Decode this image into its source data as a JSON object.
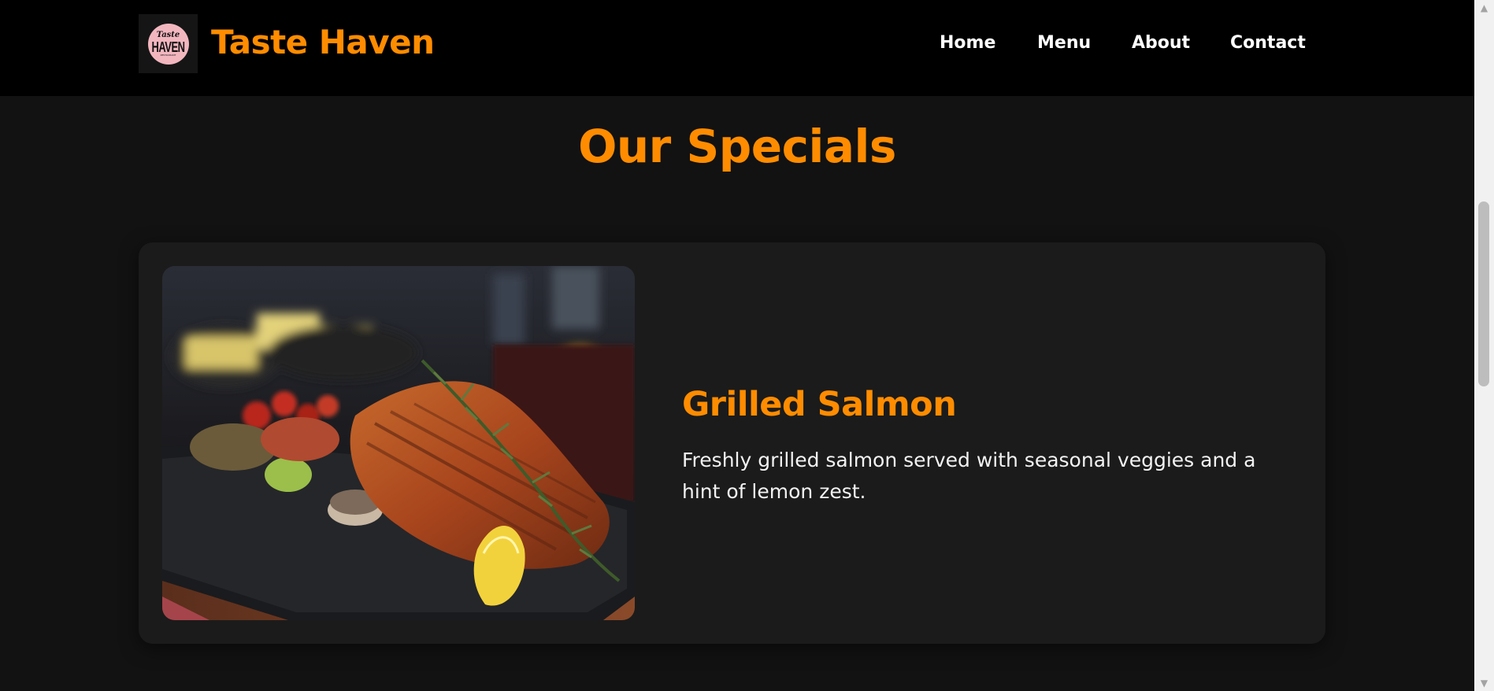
{
  "header": {
    "logo": {
      "script_text": "Taste",
      "main_text": "HAVEN",
      "small_text": "RESTAURANT",
      "background_color": "#f2b6bf"
    },
    "brand_name": "Taste Haven",
    "nav": [
      {
        "label": "Home"
      },
      {
        "label": "Menu"
      },
      {
        "label": "About"
      },
      {
        "label": "Contact"
      }
    ]
  },
  "specials": {
    "section_title": "Our Specials",
    "items": [
      {
        "title": "Grilled Salmon",
        "description": "Freshly grilled salmon served with seasonal veggies and a hint of lemon zest.",
        "image": "grilled-salmon-photo"
      }
    ]
  },
  "scrollbar": {
    "up_icon": "chevron-up-icon",
    "down_icon": "chevron-down-icon"
  },
  "colors": {
    "accent": "#ff8c00",
    "header_bg": "#000000",
    "page_bg": "#121212",
    "card_bg": "#1b1b1b",
    "text": "#ffffff"
  }
}
